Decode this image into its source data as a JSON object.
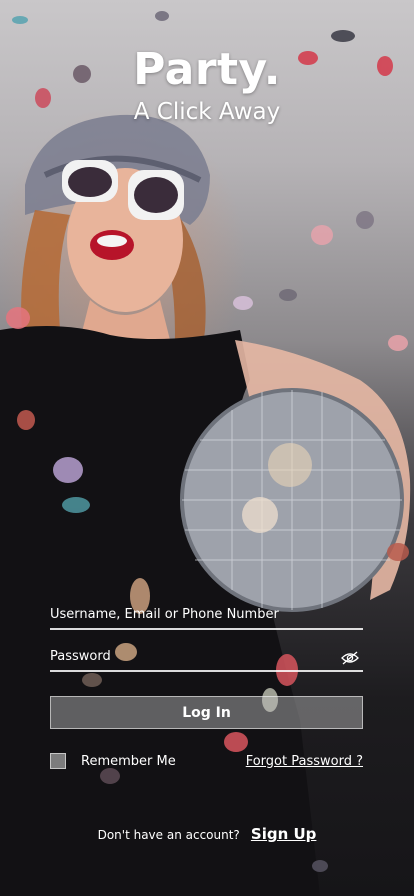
{
  "header": {
    "title": "Party.",
    "tagline": "A Click Away"
  },
  "form": {
    "username_placeholder": "Username, Email or Phone Number",
    "password_placeholder": "Password",
    "login_label": "Log In",
    "remember_label": "Remember Me",
    "remember_checked": false,
    "forgot_label": "Forgot Password ?"
  },
  "footer": {
    "prompt": "Don't have an account?",
    "signup_label": "Sign Up"
  },
  "icons": {
    "password_toggle": "eye-off-icon"
  },
  "colors": {
    "text": "#ffffff",
    "button_fill": "#bebebe",
    "checkbox_fill": "#a0a0a0"
  }
}
